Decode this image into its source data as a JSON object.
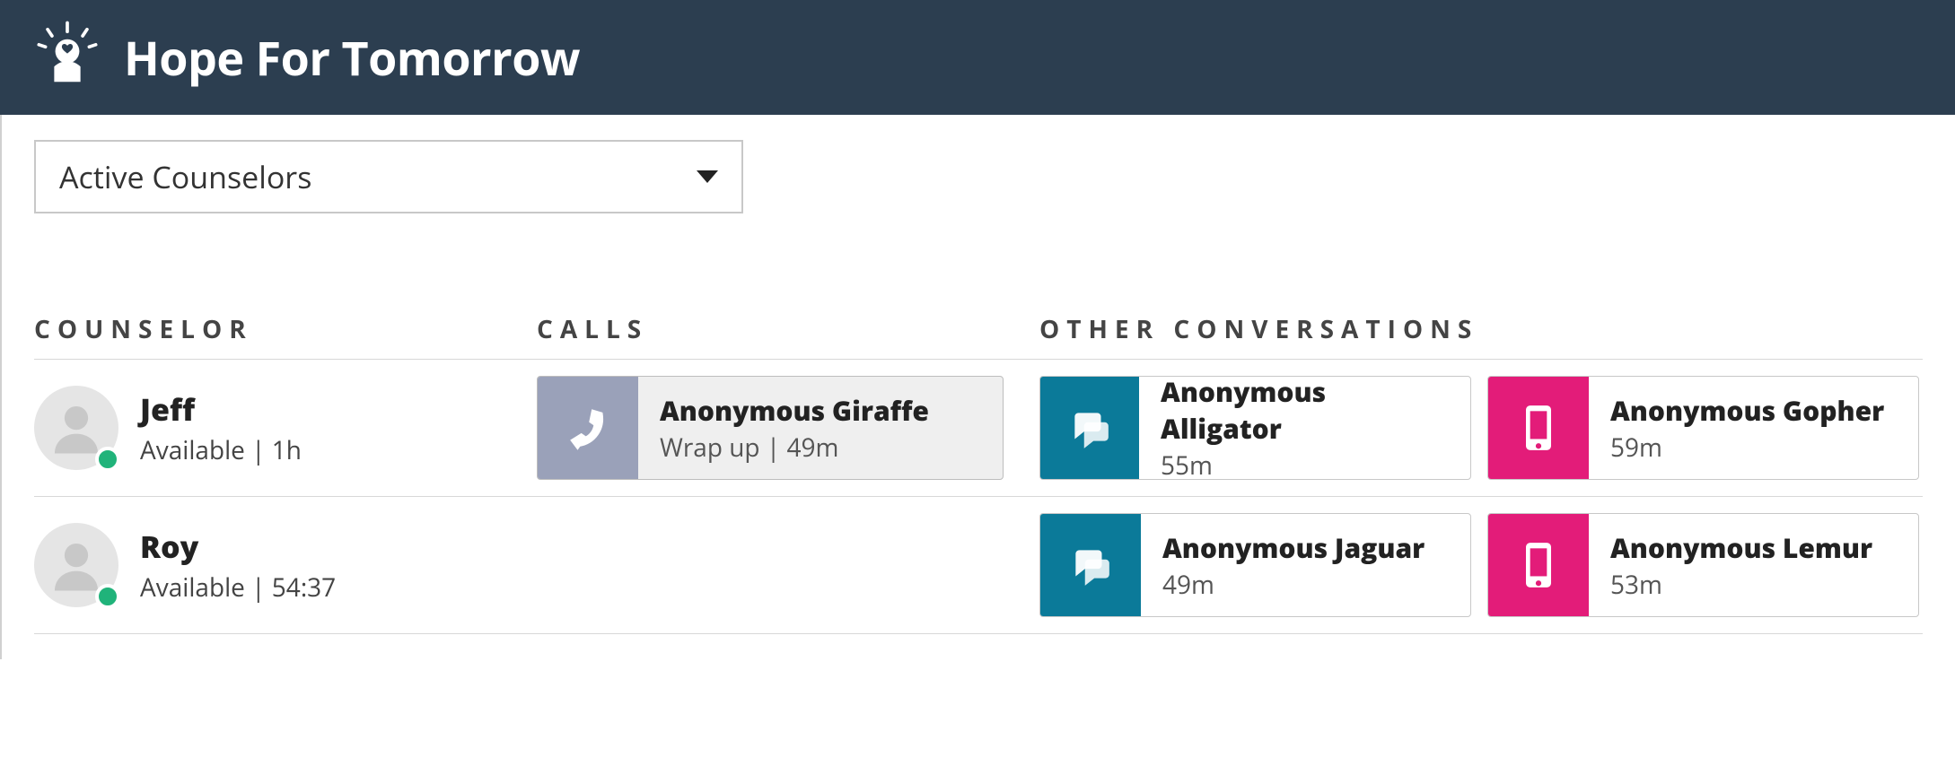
{
  "header": {
    "title": "Hope For Tomorrow"
  },
  "filter": {
    "selected": "Active Counselors"
  },
  "columns": {
    "counselor": "Counselor",
    "calls": "Calls",
    "other": "Other Conversations"
  },
  "rows": [
    {
      "counselor": {
        "name": "Jeff",
        "status": "Available | 1h"
      },
      "call": {
        "title": "Anonymous Giraffe",
        "subtitle": "Wrap up | 49m"
      },
      "other": [
        {
          "type": "chat",
          "title": "Anonymous Alligator",
          "subtitle": "55m"
        },
        {
          "type": "mobile",
          "title": "Anonymous Gopher",
          "subtitle": "59m"
        }
      ]
    },
    {
      "counselor": {
        "name": "Roy",
        "status": "Available | 54:37"
      },
      "call": null,
      "other": [
        {
          "type": "chat",
          "title": "Anonymous Jaguar",
          "subtitle": "49m"
        },
        {
          "type": "mobile",
          "title": "Anonymous Lemur",
          "subtitle": "53m"
        }
      ]
    }
  ]
}
